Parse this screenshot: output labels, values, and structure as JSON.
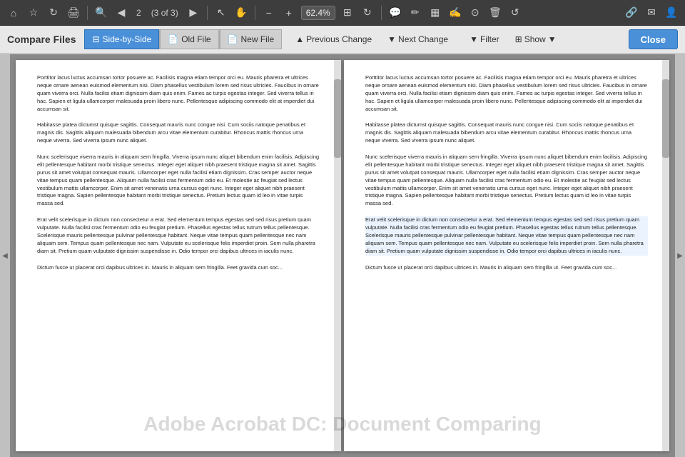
{
  "toolbar": {
    "page_num": "2",
    "page_total": "(3 of 3)",
    "zoom": "62.4%",
    "icons": {
      "home": "⌂",
      "star": "☆",
      "refresh": "↻",
      "print": "🖨",
      "zoom_in_glass": "🔍",
      "prev_page": "◀",
      "next_page": "▶",
      "cursor": "↖",
      "hand": "✋",
      "zoom_out": "−",
      "zoom_in": "+",
      "fit": "⊞",
      "grid": "⋮",
      "comment": "💬",
      "pen": "✏",
      "highlight": "▦",
      "sign": "✍",
      "stamp": "⊙",
      "delete": "🗑",
      "undo": "↺",
      "link": "🔗",
      "mail": "✉",
      "profile": "👤"
    }
  },
  "compare_bar": {
    "title": "Compare Files",
    "side_by_side_label": "Side-by-Side",
    "old_file_label": "Old File",
    "new_file_label": "New File",
    "previous_change_label": "Previous Change",
    "next_change_label": "Next Change",
    "filter_label": "Filter",
    "show_label": "Show",
    "close_label": "Close"
  },
  "doc_left": {
    "paragraphs": [
      "Porttitor lacus luctus accumsan tortor posuere ac. Facilisis magna etiam tempor orci eu. Mauris pharetra et ultrices neque ornare aenean euismod elementum nisi. Diam phasellus vestibulum lorem sed risus ultricies. Faucibus in ornare quam viverra orci. Nulla facilisi etiam dignissim diam quis enim. Fames ac turpis egestas integer. Sed viverra tellus in hac. Sapien et ligula ullamcorper malesuada proin libero nunc. Pellentesque adipiscing commodo elit at imperdiet dui accumsan sit.",
      "Habitasse platea dictumst quisque sagittis. Consequat mauris nunc congue nisi. Cum sociis natoque penatibus et magnis dis. Sagittis aliquam malesuada bibendum arcu vitae elementum curabitur. Rhoncus mattis rhoncus urna neque viverra. Sed viverra ipsum nunc aliquet.",
      "Nunc scelerisque viverra mauris in aliquam sem fringilla. Viverra ipsum nunc aliquet bibendum enim facilisis. Adipiscing elit pellentesque habitant morbi tristique senectus. Integer eget aliquet nibh praesent tristique magna sit amet. Sagittis purus sit amet volutpat consequat mauris. Ullamcorper eget nulla facilisi etiam dignissim. Cras semper auctor neque vitae tempus quam pellentesque. Aliquam nulla facilisi cras fermentum odio eu. Et molestie ac feugiat sed lectus vestibulum mattis ullamcorper. Enim sit amet venenatis urna cursus eget nunc. Integer eget aliquet nibh praesent tristique magna. Sapien pellentesque habitant morbi tristique senectus. Pretium lectus quam id leo in vitae turpis massa sed.",
      "Erat velit scelerisque in dictum non consectetur a erat. Sed elementum tempus egestas sed sed risus pretium quam vulputate. Nulla facilisi cras fermentum odio eu feugiat pretium. Phasellus egestas tellus rutrum tellus pellentesque. Scelerisque mauris pellentesque pulvinar pellentesque habitant. Neque vitae tempus quam pellentesque nec nam aliquam sem. Tempus quam pellentesque nec nam. Vulputate eu scelerisque felis imperdiet proin. Sem nulla pharetra diam sit. Pretium quam vulputate dignissim suspendisse in. Odio tempor orci dapibus ultrices in iaculis nunc.",
      "Dictum fusce ut placerat orci dapibus ultrices in. Mauris in aliquam sem fringilla. Feet gravida cum soc..."
    ]
  },
  "doc_right": {
    "paragraphs": [
      "Porttitor lacus luctus accumsan tortor posuere ac. Facilisis magna etiam tempor orci eu. Mauris pharetra et ultrices neque ornare aenean euismod elementum nisi. Diam phasellus vestibulum lorem sed risus ultricies. Faucibus in ornare quam viverra orci. Nulla facilisi etiam dignissim diam quis enim. Fames ac turpis egestas integer. Sed viverra tellus in hac. Sapien et ligula ullamcorper malesuada proin libero nunc. Pellentesque adipiscing commodo elit at imperdiet dui accumsan sit.",
      "Habitasse platea dictumst quisque sagittis. Consequat mauris nunc congue nisi. Cum sociis natoque penatibus et magnis dis. Sagittis aliquam malesuada bibendum arcu vitae elementum curabitur. Rhoncus mattis rhoncus urna neque viverra. Sed viverra ipsum nunc aliquet.",
      "Nunc scelerisque viverra mauris in aliquam sem fringilla. Viverra ipsum nunc aliquet bibendum enim facilisis. Adipiscing elit pellentesque habitant morbi tristique senectus. Integer eget aliquet nibh praesent tristique magna sit amet. Sagittis purus sit amet volutpat consequat mauris. Ullamcorper eget nulla facilisi etiam dignissim. Cras semper auctor neque vitae tempus quam pellentesque. Aliquam nulla facilisi cras fermentum odio eu. Et molestie ac feugiat sed lectus vestibulum mattis ullamcorper. Enim sit amet venenatis urna cursus eget nunc. Integer eget aliquet nibh praesent tristique magna. Sapien pellentesque habitant morbi tristique senectus. Pretium lectus quam id leo in vitae turpis massa sed.",
      "Erat velit scelerisque in dictum non consectetur a erat. Sed elementum tempus egestas sed sed risus pretium quam vulputate. Nulla facilisi cras fermentum odio eu feugiat pretium. Phasellus egestas tellus rutrum tellus pellentesque. Scelerisque mauris pellentesque pulvinar pellentesque habitant. Neque vitae tempus quam pellentesque nec nam aliquam sem. Tempus quam pellentesque nec nam. Vulputate eu scelerisque felis imperdiet proin. Sem nulla pharetra diam sit. Pretium quam vulputate dignissim suspendisse in. Odio tempor orci dapibus ultrices in iaculis nunc.",
      "Dictum fusce ut placerat orci dapibus ultrices in. Mauris in aliquam sem fringilla ut. Feet gravida cum soc..."
    ]
  },
  "watermark": "Adobe Acrobat DC: Document Comparing"
}
